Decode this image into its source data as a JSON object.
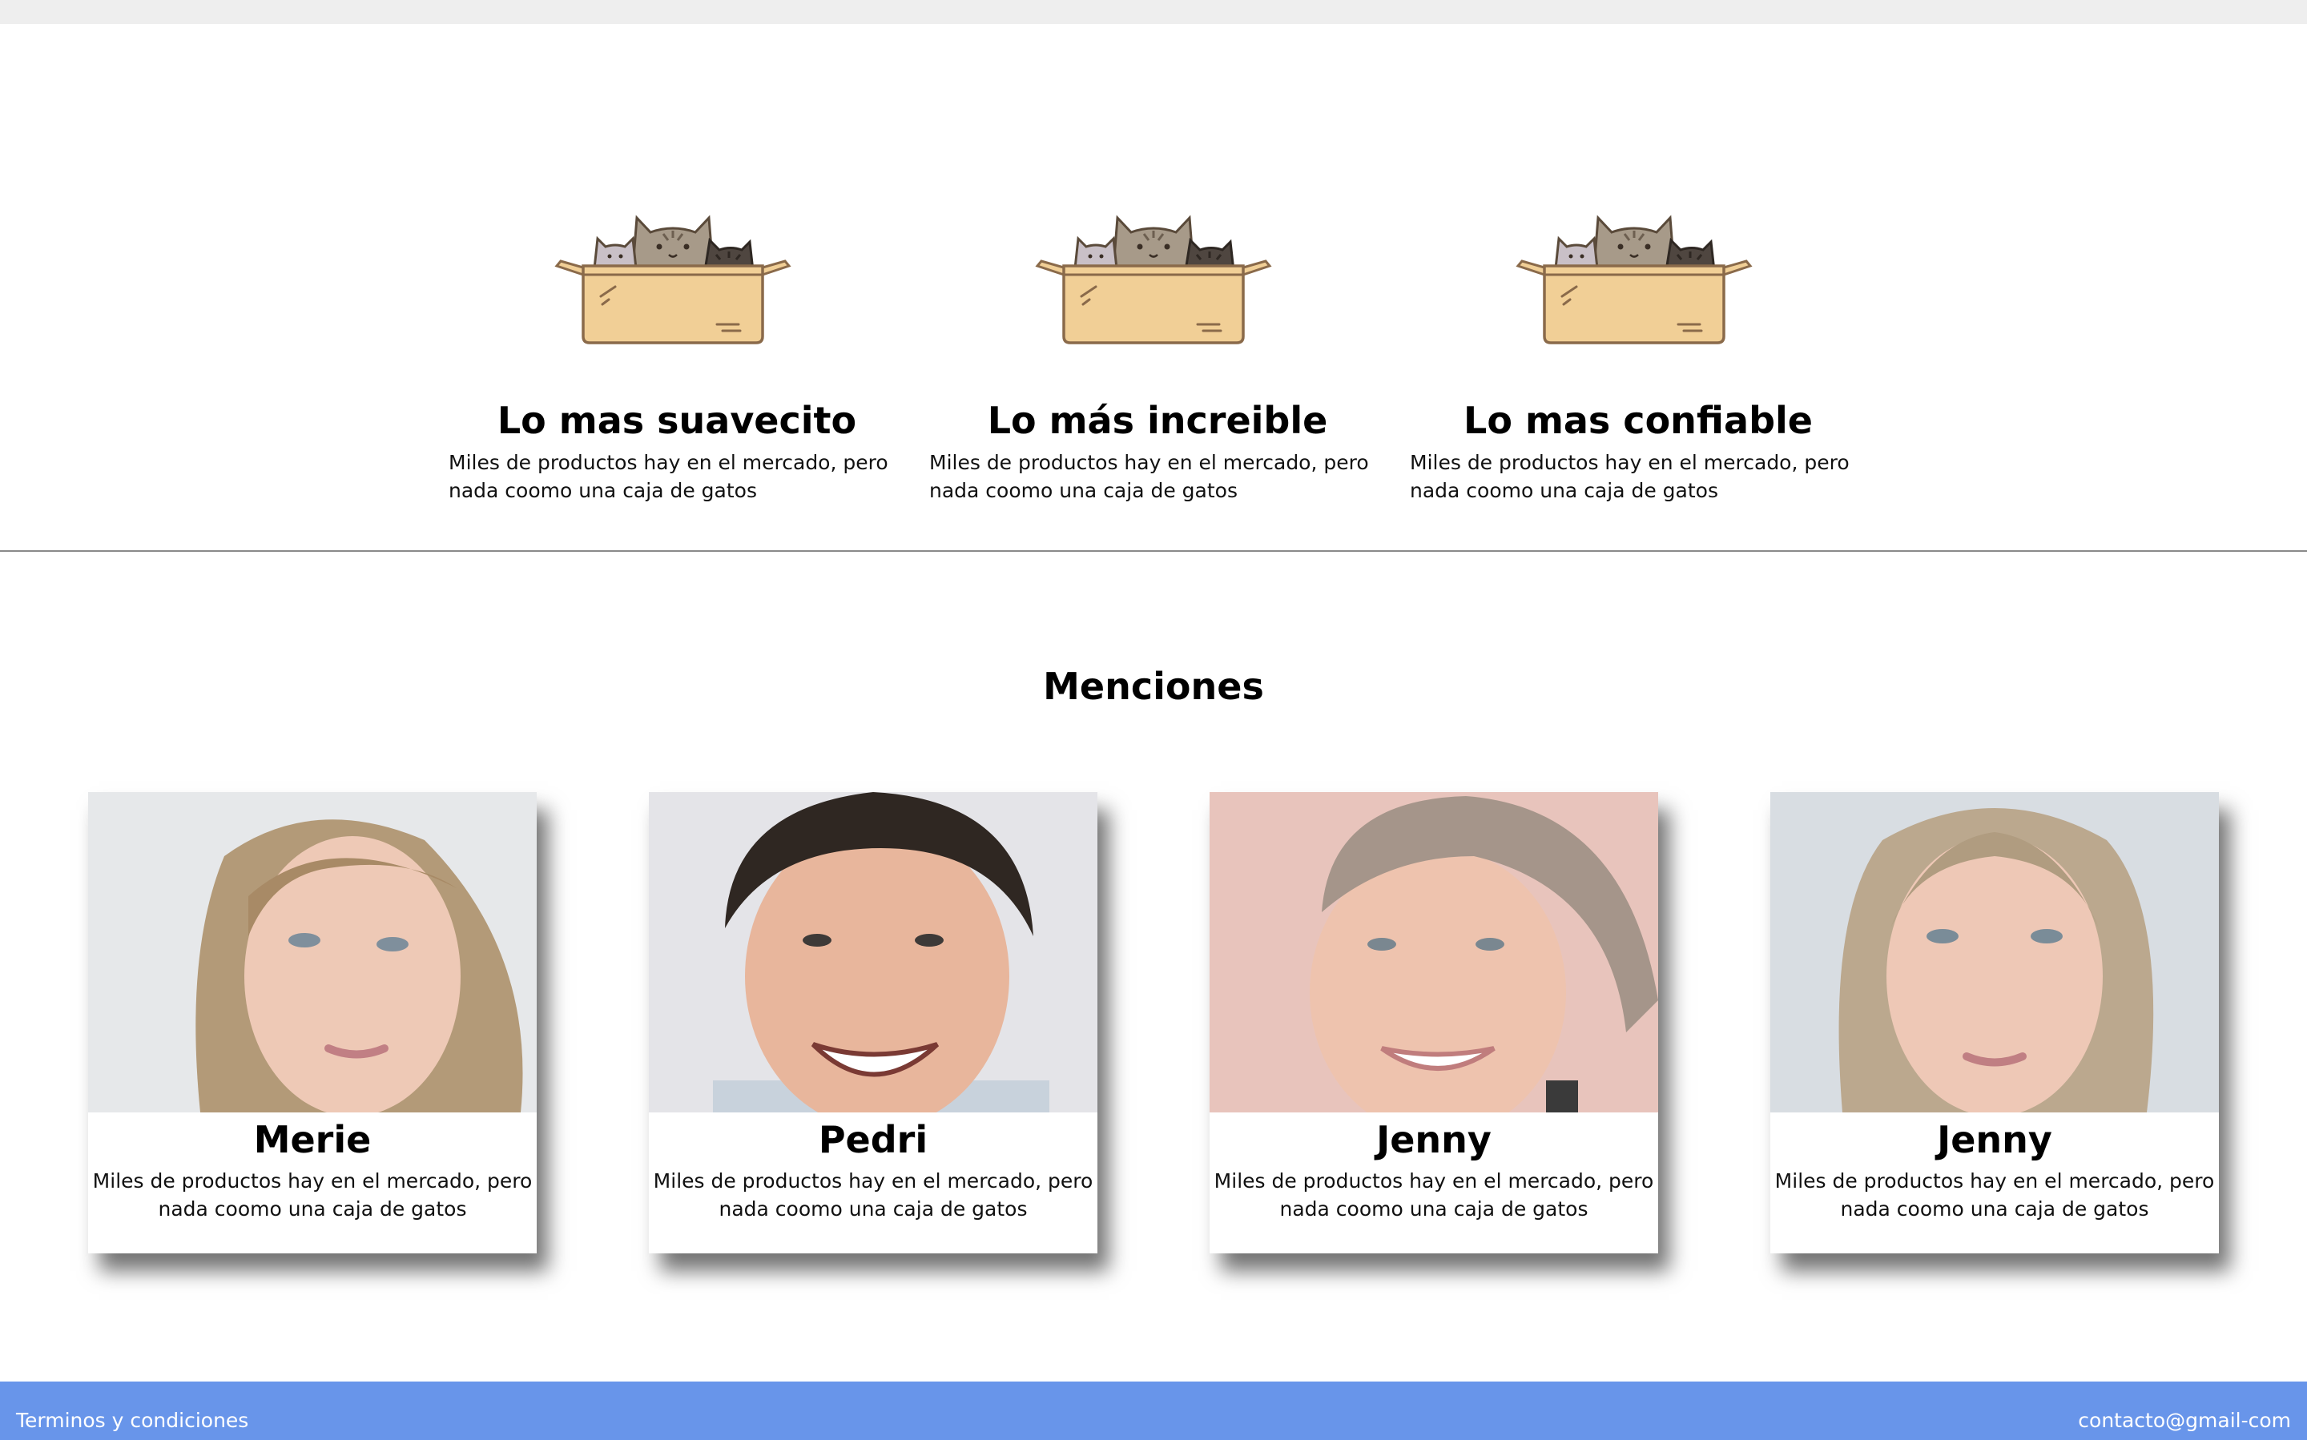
{
  "features": [
    {
      "title": "Lo mas suavecito",
      "text": "Miles de productos hay en el mercado, pero nada coomo una caja de gatos"
    },
    {
      "title": "Lo más increible",
      "text": "Miles de productos hay en el mercado, pero nada coomo una caja de gatos"
    },
    {
      "title": "Lo mas confiable",
      "text": "Miles de productos hay en el mercado, pero nada coomo una caja de gatos"
    }
  ],
  "mentions": {
    "title": "Menciones",
    "people": [
      {
        "name": "Merie",
        "text": "Miles de productos hay en el mercado, pero nada coomo una caja de gatos"
      },
      {
        "name": "Pedri",
        "text": "Miles de productos hay en el mercado, pero nada coomo una caja de gatos"
      },
      {
        "name": "Jenny",
        "text": "Miles de productos hay en el mercado, pero nada coomo una caja de gatos"
      },
      {
        "name": "Jenny",
        "text": "Miles de productos hay en el mercado, pero nada coomo una caja de gatos"
      }
    ]
  },
  "footer": {
    "terms": "Terminos y condiciones",
    "contact": "contacto@gmail-com"
  },
  "colors": {
    "footer_bg": "#6895ea",
    "box": "#f1cf96",
    "box_outline": "#8a6a4a"
  }
}
